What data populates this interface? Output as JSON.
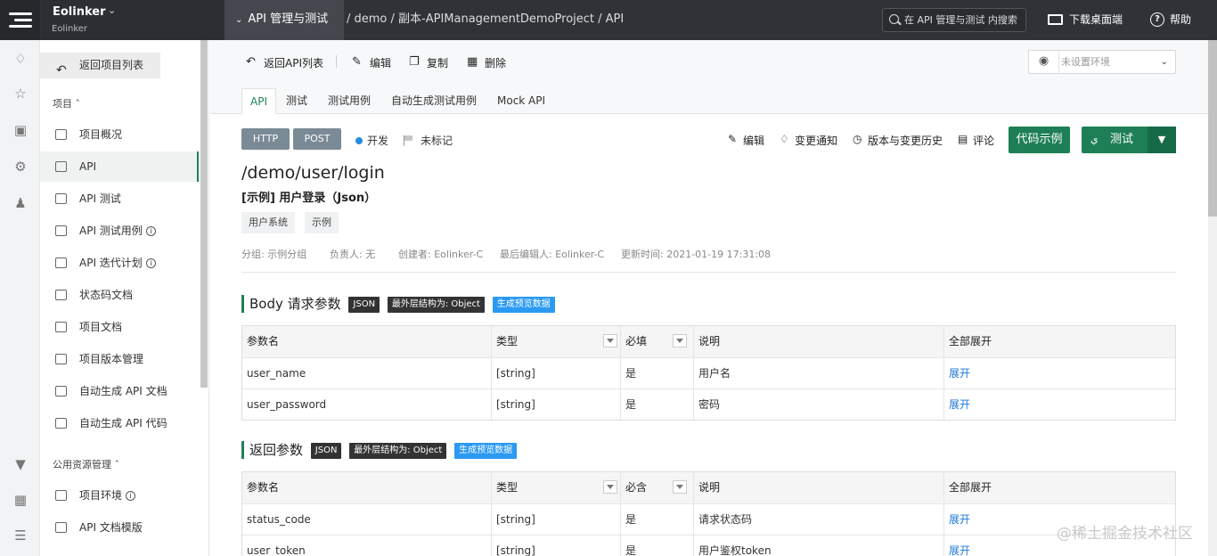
{
  "topbar": {
    "brand": "Eolinker",
    "brand_sub": "Eolinker",
    "module": "API 管理与测试",
    "breadcrumb": "/ demo / 副本-APIManagementDemoProject / API",
    "search_placeholder": "在 API 管理与测试 内搜索",
    "download": "下载桌面端",
    "help": "帮助"
  },
  "rail_icons": [
    "bell-icon",
    "star-icon",
    "calendar-icon",
    "settings-icon",
    "add-user-icon",
    "inbox-icon",
    "keyboard-icon",
    "list-icon"
  ],
  "sidebar": {
    "back": "返回项目列表",
    "project_section": "项目",
    "items": [
      {
        "label": "项目概况",
        "icon": "dashboard-icon"
      },
      {
        "label": "API",
        "icon": "tag-icon"
      },
      {
        "label": "API 测试",
        "icon": "bolt-icon"
      },
      {
        "label": "API 测试用例",
        "icon": "clipboard-icon"
      },
      {
        "label": "API 迭代计划",
        "icon": "calendar-icon"
      },
      {
        "label": "状态码文档",
        "icon": "doc-icon"
      },
      {
        "label": "项目文档",
        "icon": "doc-icon"
      },
      {
        "label": "项目版本管理",
        "icon": "version-icon"
      },
      {
        "label": "自动生成 API 文档",
        "icon": "robot-icon"
      },
      {
        "label": "自动生成 API 代码",
        "icon": "robot-icon"
      }
    ],
    "public_section": "公用资源管理",
    "public_items": [
      {
        "label": "项目环境",
        "icon": "cube-icon"
      },
      {
        "label": "API 文档模版",
        "icon": "cube-icon"
      }
    ]
  },
  "toolbar": {
    "back": "返回API列表",
    "edit": "编辑",
    "copy": "复制",
    "delete": "删除",
    "env": "未设置环境"
  },
  "tabs": [
    "API",
    "测试",
    "测试用例",
    "自动生成测试用例",
    "Mock API"
  ],
  "api": {
    "protocol": "HTTP",
    "method": "POST",
    "status": "开发",
    "mark": "未标记",
    "actions": {
      "edit": "编辑",
      "notify": "变更通知",
      "history": "版本与变更历史",
      "comment": "评论"
    },
    "code_example": "代码示例",
    "test": "测试",
    "path": "/demo/user/login",
    "title": "[示例] 用户登录（Json）",
    "tags": [
      "用户系统",
      "示例"
    ],
    "meta": {
      "group": "分组: 示例分组",
      "owner": "负责人: 无",
      "creator": "创建者: Eolinker-C",
      "editor": "最后编辑人: Eolinker-C",
      "updated": "更新时间:   2021-01-19 17:31:08"
    }
  },
  "body_params": {
    "title": "Body 请求参数",
    "badge_json": "JSON",
    "badge_struct": "最外层结构为: Object",
    "badge_preview": "生成预览数据",
    "headers": [
      "参数名",
      "类型",
      "必填",
      "说明",
      "全部展开"
    ],
    "rows": [
      [
        "user_name",
        "[string]",
        "是",
        "用户名",
        "展开"
      ],
      [
        "user_password",
        "[string]",
        "是",
        "密码",
        "展开"
      ]
    ]
  },
  "return_params": {
    "title": "返回参数",
    "badge_json": "JSON",
    "badge_struct": "最外层结构为: Object",
    "badge_preview": "生成预览数据",
    "headers": [
      "参数名",
      "类型",
      "必含",
      "说明",
      "全部展开"
    ],
    "rows": [
      [
        "status_code",
        "[string]",
        "是",
        "请求状态码",
        "展开"
      ],
      [
        "user_token",
        "[string]",
        "是",
        "用户鉴权token",
        "展开"
      ]
    ]
  },
  "watermark": "@稀土掘金技术社区",
  "colors": {
    "accent": "#1e7f56",
    "topbar": "#2f3237",
    "link": "#1e7ad6"
  }
}
